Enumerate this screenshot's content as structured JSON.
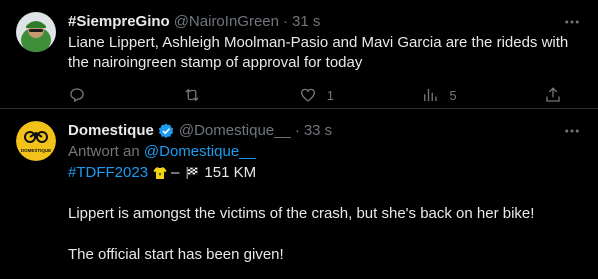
{
  "tweets": [
    {
      "display_name": "#SiempreGino",
      "handle": "@NairoInGreen",
      "separator": "·",
      "time": "31 s",
      "text": "Liane Lippert, Ashleigh Moolman-Pasio and Mavi Garcia are the rideds with the nairoingreen stamp of approval for today",
      "actions": {
        "reply_count": "",
        "retweet_count": "",
        "like_count": "1",
        "views_count": "5"
      }
    },
    {
      "display_name": "Domestique",
      "handle": "@Domestique__",
      "separator": "·",
      "time": "33 s",
      "reply_prefix": "Antwort an",
      "reply_handle": "@Domestique__",
      "hashtag": "#TDFF2023",
      "hashtag_suffix": "–",
      "distance": "151 KM",
      "line1": "Lippert is amongst the victims of the crash, but she's back on her bike!",
      "line2": "The official start has been given!",
      "avatar_label": "DOMESTIQUE"
    }
  ],
  "colors": {
    "background": "#000000",
    "text": "#e7e9ea",
    "muted": "#71767b",
    "link": "#1d9bf0",
    "divider": "#2f3336",
    "verified": "#1d9bf0",
    "domestique_avatar": "#f2c21b"
  },
  "icons": [
    "more-icon",
    "reply-icon",
    "retweet-icon",
    "like-icon",
    "views-icon",
    "share-icon",
    "verified-icon",
    "jersey-icon",
    "checkered-flag-icon"
  ]
}
